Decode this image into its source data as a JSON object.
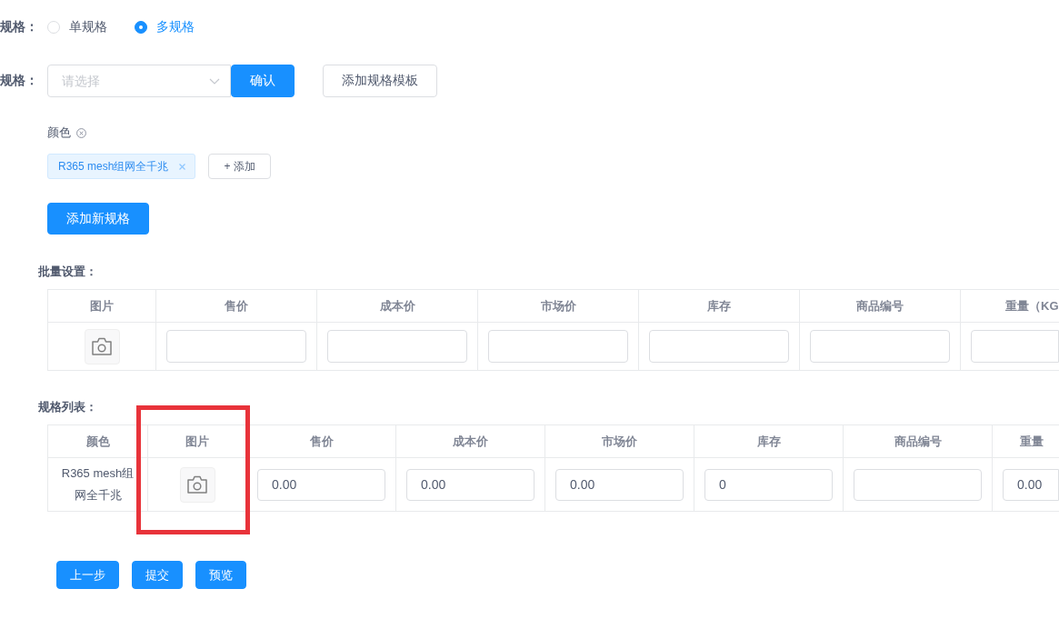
{
  "spec_type": {
    "label": "规格：",
    "options": [
      {
        "label": "单规格",
        "selected": false
      },
      {
        "label": "多规格",
        "selected": true
      }
    ]
  },
  "spec_picker": {
    "label": "规格：",
    "select": {
      "placeholder": "请选择"
    },
    "confirm_button": "确认",
    "template_button": "添加规格模板"
  },
  "specs": [
    {
      "name": "颜色",
      "values": [
        "R365 mesh组网全千兆"
      ],
      "add_button": "+ 添加"
    }
  ],
  "add_spec_button": "添加新规格",
  "batch_settings": {
    "title": "批量设置：",
    "columns": [
      "图片",
      "售价",
      "成本价",
      "市场价",
      "库存",
      "商品编号",
      "重量（KG"
    ],
    "row": [
      {
        "kind": "image"
      },
      {
        "kind": "input"
      },
      {
        "kind": "input"
      },
      {
        "kind": "input"
      },
      {
        "kind": "input"
      },
      {
        "kind": "input"
      },
      {
        "kind": "input"
      }
    ]
  },
  "spec_list": {
    "title": "规格列表：",
    "columns": [
      {
        "label": "颜色",
        "highlighted": false
      },
      {
        "label": "图片",
        "highlighted": true
      },
      {
        "label": "售价",
        "highlighted": false
      },
      {
        "label": "成本价",
        "highlighted": false
      },
      {
        "label": "市场价",
        "highlighted": false
      },
      {
        "label": "库存",
        "highlighted": false
      },
      {
        "label": "商品编号",
        "highlighted": false
      },
      {
        "label": "重量",
        "highlighted": false
      }
    ],
    "rows": [
      [
        {
          "kind": "text",
          "text": "R365 mesh组网全千兆"
        },
        {
          "kind": "image"
        },
        {
          "kind": "input",
          "value": "0.00"
        },
        {
          "kind": "input",
          "value": "0.00"
        },
        {
          "kind": "input",
          "value": "0.00"
        },
        {
          "kind": "input",
          "value": "0"
        },
        {
          "kind": "input"
        },
        {
          "kind": "input",
          "value": "0.00"
        }
      ]
    ]
  },
  "actions": [
    "上一步",
    "提交",
    "预览"
  ]
}
